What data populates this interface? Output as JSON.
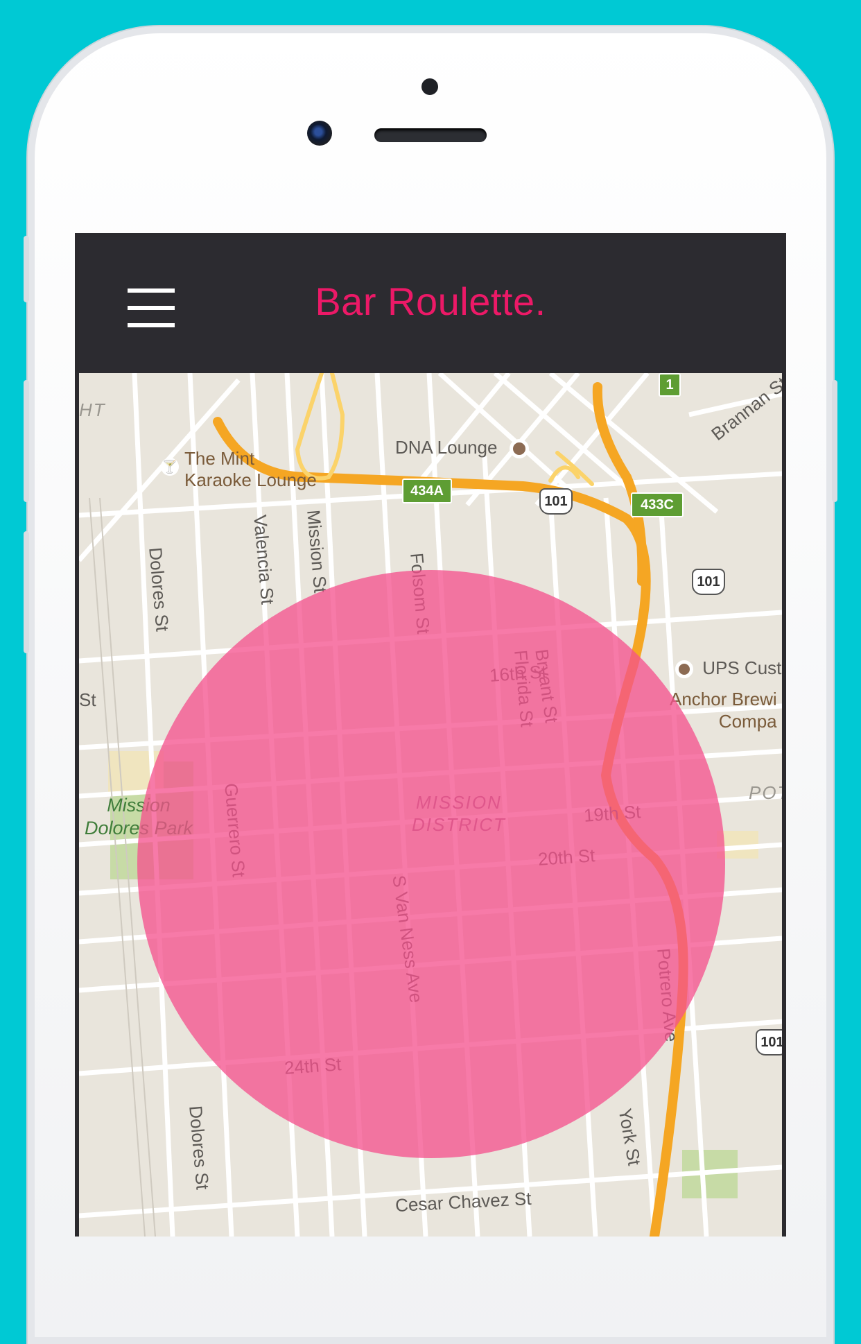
{
  "app": {
    "title": "Bar Roulette."
  },
  "colors": {
    "background": "#00c9d4",
    "header": "#2c2b30",
    "accent": "#ec1967",
    "radius_fill": "#f4508c"
  },
  "header": {
    "menu_icon": "hamburger-menu-icon"
  },
  "map": {
    "streets": [
      "16th St",
      "19th St",
      "20th St",
      "24th St",
      "Cesar Chavez St",
      "Dolores St",
      "Dolores St",
      "Valencia St",
      "Mission St",
      "Guerrero St",
      "S Van Ness Ave",
      "Folsom St",
      "Bryant St",
      "Florida St",
      "Potrero Ave",
      "York St",
      "Brannan St",
      "St"
    ],
    "places": [
      "DNA Lounge",
      "The Mint",
      "Karaoke Lounge",
      "UPS Cust",
      "Anchor Brewi",
      "Compa",
      "Mission",
      "Dolores Park",
      "MISSION",
      "DISTRICT",
      "HT",
      "POT"
    ],
    "shields": {
      "exit_434a": "434A",
      "exit_433c": "433C",
      "route_1": "1",
      "us_101_a": "101",
      "us_101_b": "101",
      "us_101_c": "101"
    },
    "radius_overlay": "circle"
  }
}
